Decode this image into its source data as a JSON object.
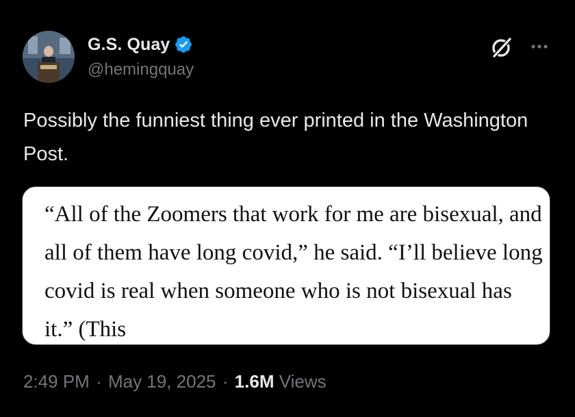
{
  "tweet": {
    "author": {
      "display_name": "G.S. Quay",
      "handle": "@hemingquay",
      "verified": true,
      "verified_color": "#1d9bf0"
    },
    "text": "Possibly the funniest thing ever printed in the Washington Post.",
    "quote_image_text": "“All of the Zoomers that work for me are bisexual, and all of them have long covid,” he said. “I’ll believe long covid is real when someone who is not bisexual has it.” (This",
    "timestamp": {
      "time": "2:49 PM",
      "separator": "·",
      "date": "May 19, 2025"
    },
    "views": {
      "count": "1.6M",
      "label": "Views"
    }
  },
  "icons": {
    "avatar": "avatar",
    "verified": "verified-badge-icon",
    "grok": "grok-icon",
    "more": "more-icon"
  },
  "colors": {
    "background": "#000000",
    "primary_text": "#e7e9ea",
    "secondary_text": "#71767b",
    "card_background": "#ffffff"
  }
}
